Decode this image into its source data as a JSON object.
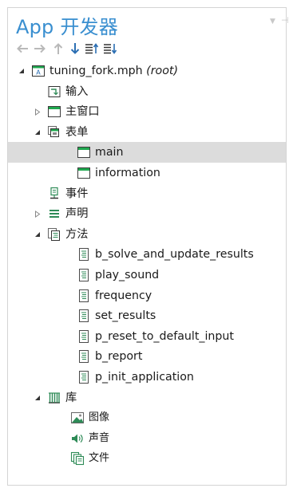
{
  "panel": {
    "title": "App 开发器",
    "dropdown_icon": "chevron-down-icon",
    "pin_icon": "pin-icon"
  },
  "toolbar": {
    "buttons": [
      {
        "icon": "arrow-left-icon"
      },
      {
        "icon": "arrow-right-icon"
      },
      {
        "icon": "arrow-up-icon"
      },
      {
        "icon": "arrow-down-icon"
      },
      {
        "icon": "move-up-list-icon"
      },
      {
        "icon": "move-down-list-icon"
      }
    ],
    "colors": {
      "disabled": "#b9b9b9",
      "enabled": "#2c6fb3"
    }
  },
  "tree": {
    "root": {
      "label": "tuning_fork.mph",
      "suffix": "(root)",
      "icon": "application-icon",
      "expanded": true
    },
    "input": {
      "label": "输入",
      "icon": "input-icon"
    },
    "main_window": {
      "label": "主窗口",
      "icon": "window-icon",
      "expanded": false
    },
    "forms": {
      "label": "表单",
      "icon": "forms-icon",
      "expanded": true,
      "items": [
        {
          "label": "main",
          "icon": "form-icon",
          "selected": true
        },
        {
          "label": "information",
          "icon": "form-icon",
          "selected": false
        }
      ]
    },
    "events": {
      "label": "事件",
      "icon": "events-icon"
    },
    "declarations": {
      "label": "声明",
      "icon": "declarations-icon",
      "expanded": false
    },
    "methods": {
      "label": "方法",
      "icon": "methods-icon",
      "expanded": true,
      "items": [
        {
          "label": "b_solve_and_update_results",
          "icon": "method-icon"
        },
        {
          "label": "play_sound",
          "icon": "method-icon"
        },
        {
          "label": "frequency",
          "icon": "method-icon"
        },
        {
          "label": "set_results",
          "icon": "method-icon"
        },
        {
          "label": "p_reset_to_default_input",
          "icon": "method-icon"
        },
        {
          "label": "b_report",
          "icon": "method-icon"
        },
        {
          "label": "p_init_application",
          "icon": "method-icon"
        }
      ]
    },
    "libraries": {
      "label": "库",
      "icon": "libraries-icon",
      "expanded": true,
      "items": [
        {
          "label": "图像",
          "icon": "image-icon"
        },
        {
          "label": "声音",
          "icon": "sound-icon"
        },
        {
          "label": "文件",
          "icon": "files-icon"
        }
      ]
    }
  },
  "colors": {
    "title": "#3a8fd0",
    "selection": "#dcdcdc",
    "border": "#d4d4d4"
  }
}
